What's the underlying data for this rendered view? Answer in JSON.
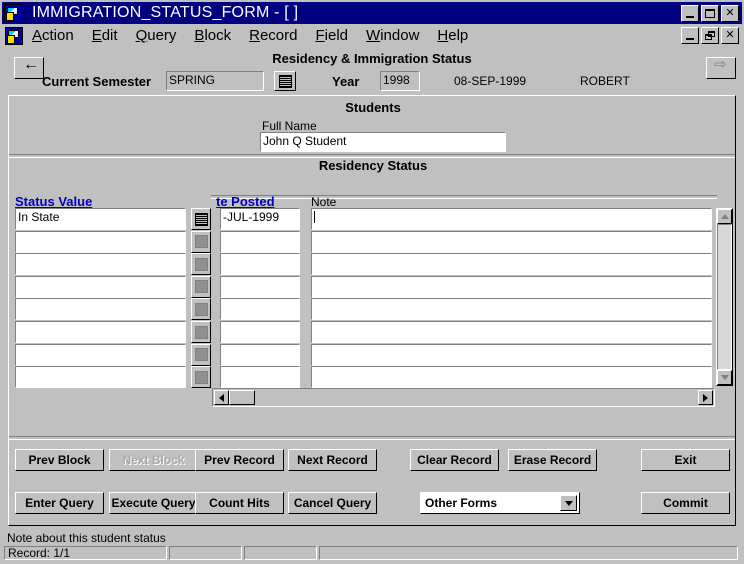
{
  "window": {
    "title": "IMMIGRATION_STATUS_FORM - [ ]",
    "minimize_label": "_",
    "maximize_label": "□",
    "close_label": "✕"
  },
  "mdi": {
    "minimize_label": "_",
    "restore_label": "❐",
    "close_label": "✕"
  },
  "menu": {
    "items": [
      {
        "label": "Action",
        "accel": "A"
      },
      {
        "label": "Edit",
        "accel": "E"
      },
      {
        "label": "Query",
        "accel": "Q"
      },
      {
        "label": "Block",
        "accel": "B"
      },
      {
        "label": "Record",
        "accel": "R"
      },
      {
        "label": "Field",
        "accel": "F"
      },
      {
        "label": "Window",
        "accel": "W"
      },
      {
        "label": "Help",
        "accel": "H"
      }
    ]
  },
  "toolbar": {
    "title": "Residency & Immigration Status",
    "back_icon": "arrow-left-icon",
    "forward_icon": "arrow-right-icon",
    "semester_label": "Current Semester",
    "semester_value": "SPRING",
    "semester_lov_icon": "list-of-values-icon",
    "year_label": "Year",
    "year_value": "1998",
    "date": "08-SEP-1999",
    "user": "ROBERT"
  },
  "students": {
    "section_title": "Students",
    "full_name_label": "Full Name",
    "full_name_value": "John Q Student"
  },
  "residency": {
    "section_title": "Residency Status",
    "columns": {
      "status_value": "Status Value",
      "date_posted": "te Posted",
      "note": "Note"
    },
    "rows": [
      {
        "status_value": "In State",
        "lov_icon": "list-of-values-icon",
        "lov_active": true,
        "date_posted": "-JUL-1999",
        "note": ""
      },
      {
        "status_value": "",
        "lov_icon": "list-of-values-icon",
        "lov_active": false,
        "date_posted": "",
        "note": ""
      },
      {
        "status_value": "",
        "lov_icon": "list-of-values-icon",
        "lov_active": false,
        "date_posted": "",
        "note": ""
      },
      {
        "status_value": "",
        "lov_icon": "list-of-values-icon",
        "lov_active": false,
        "date_posted": "",
        "note": ""
      },
      {
        "status_value": "",
        "lov_icon": "list-of-values-icon",
        "lov_active": false,
        "date_posted": "",
        "note": ""
      },
      {
        "status_value": "",
        "lov_icon": "list-of-values-icon",
        "lov_active": false,
        "date_posted": "",
        "note": ""
      },
      {
        "status_value": "",
        "lov_icon": "list-of-values-icon",
        "lov_active": false,
        "date_posted": "",
        "note": ""
      },
      {
        "status_value": "",
        "lov_icon": "list-of-values-icon",
        "lov_active": false,
        "date_posted": "",
        "note": ""
      }
    ],
    "vscroll": {
      "up_icon": "scroll-up-icon",
      "down_icon": "scroll-down-icon"
    },
    "hscroll": {
      "left_icon": "scroll-left-icon",
      "right_icon": "scroll-right-icon"
    }
  },
  "actions": {
    "row1": [
      {
        "label": "Prev Block",
        "name": "prev-block-button",
        "disabled": false
      },
      {
        "label": "Next Block",
        "name": "next-block-button",
        "disabled": true
      },
      {
        "label": "Prev Record",
        "name": "prev-record-button",
        "disabled": false
      },
      {
        "label": "Next Record",
        "name": "next-record-button",
        "disabled": false
      },
      {
        "label": "Clear Record",
        "name": "clear-record-button",
        "disabled": false
      },
      {
        "label": "Erase Record",
        "name": "erase-record-button",
        "disabled": false
      },
      {
        "label": "Exit",
        "name": "exit-button",
        "disabled": false
      }
    ],
    "row2": [
      {
        "label": "Enter Query",
        "name": "enter-query-button",
        "disabled": false
      },
      {
        "label": "Execute Query",
        "name": "execute-query-button",
        "disabled": false
      },
      {
        "label": "Count Hits",
        "name": "count-hits-button",
        "disabled": false
      },
      {
        "label": "Cancel Query",
        "name": "cancel-query-button",
        "disabled": false
      },
      {
        "label": "Commit",
        "name": "commit-button",
        "disabled": false
      }
    ],
    "other_forms": {
      "selected": "Other Forms",
      "dropdown_icon": "chevron-down-icon"
    }
  },
  "status": {
    "message": "Note about this student status",
    "record": "Record: 1/1",
    "cell2": "",
    "cell3": "",
    "cell4": ""
  }
}
